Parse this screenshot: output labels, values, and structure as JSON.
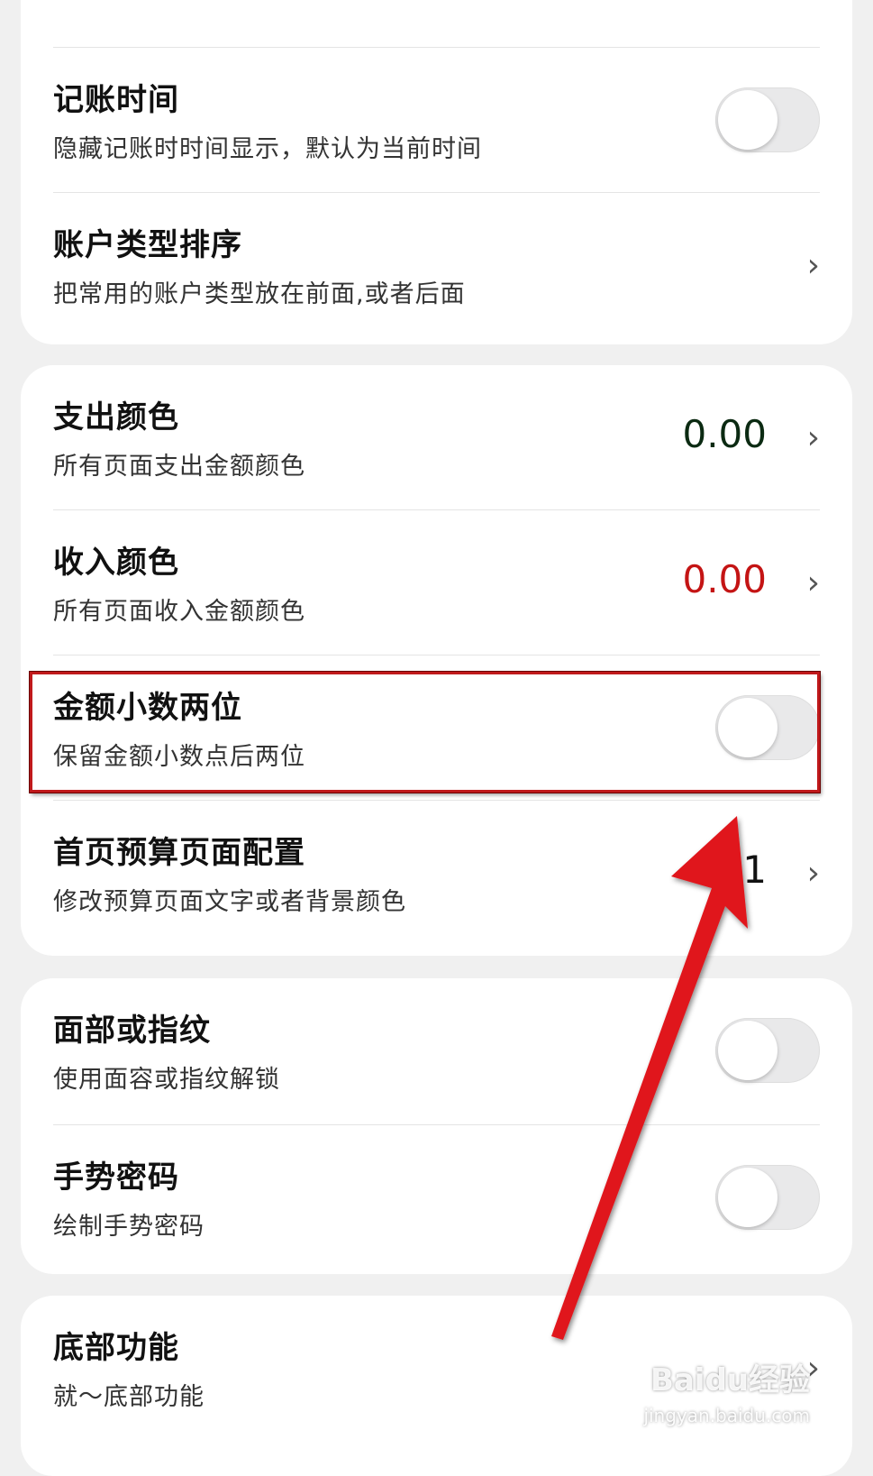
{
  "settings": {
    "bookkeeping_time": {
      "title": "记账时间",
      "desc": "隐藏记账时时间显示，默认为当前时间",
      "enabled": false
    },
    "account_sort": {
      "title": "账户类型排序",
      "desc": "把常用的账户类型放在前面,或者后面",
      "chevron": "›"
    },
    "expense_color": {
      "title": "支出颜色",
      "desc": "所有页面支出金额颜色",
      "value": "0.00",
      "color": "#0b2a12",
      "chevron": "›"
    },
    "income_color": {
      "title": "收入颜色",
      "desc": "所有页面收入金额颜色",
      "value": "0.00",
      "color": "#c41414",
      "chevron": "›"
    },
    "two_decimals": {
      "title": "金额小数两位",
      "desc": "保留金额小数点后两位",
      "enabled": false
    },
    "budget_config": {
      "title": "首页预算页面配置",
      "desc": "修改预算页面文字或者背景颜色",
      "value": "01",
      "chevron": "›"
    },
    "biometric": {
      "title": "面部或指纹",
      "desc": "使用面容或指纹解锁",
      "enabled": false
    },
    "gesture_pwd": {
      "title": "手势密码",
      "desc": "绘制手势密码",
      "enabled": false
    },
    "bottom_func": {
      "title": "底部功能",
      "desc": "就～底部功能",
      "chevron": "›"
    }
  },
  "annotation": {
    "highlight_color": "#c0191b",
    "arrow_color": "#e0161c"
  },
  "watermark": {
    "brand": "Baidu经验",
    "url": "jingyan.baidu.com"
  }
}
